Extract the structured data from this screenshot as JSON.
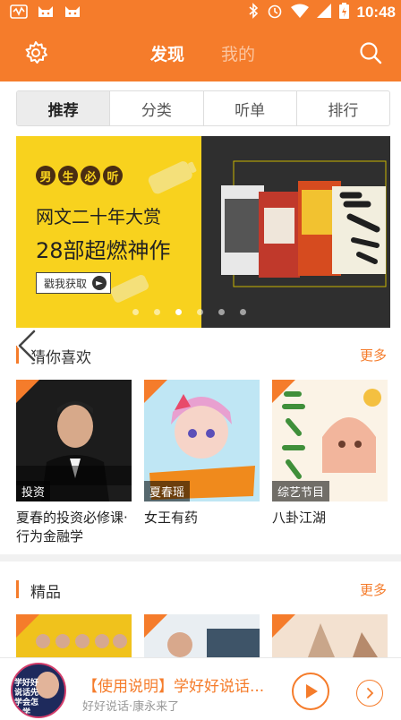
{
  "status_bar": {
    "time": "10:48"
  },
  "header": {
    "tabs": [
      {
        "label": "发现"
      },
      {
        "label": "我的"
      }
    ]
  },
  "segments": [
    {
      "label": "推荐"
    },
    {
      "label": "分类"
    },
    {
      "label": "听单"
    },
    {
      "label": "排行"
    }
  ],
  "banner": {
    "badge": [
      "男",
      "生",
      "必",
      "听"
    ],
    "line1": "网文二十年大赏",
    "line2": "28部超燃神作",
    "button": "戳我获取"
  },
  "guess_section": {
    "title": "猜你喜欢",
    "more": "更多",
    "items": [
      {
        "cover_label": "投资",
        "name": "夏春的投资必修课·行为金融学"
      },
      {
        "cover_label": "夏春瑶",
        "name": "女王有药"
      },
      {
        "cover_label": "综艺节目",
        "name": "八卦江湖"
      }
    ]
  },
  "premium_section": {
    "title": "精品",
    "more": "更多"
  },
  "player": {
    "title": "【使用说明】学好好说话...",
    "subtitle": "好好说话·康永来了",
    "thumb_text": "学好好说话先学会怎么学"
  }
}
